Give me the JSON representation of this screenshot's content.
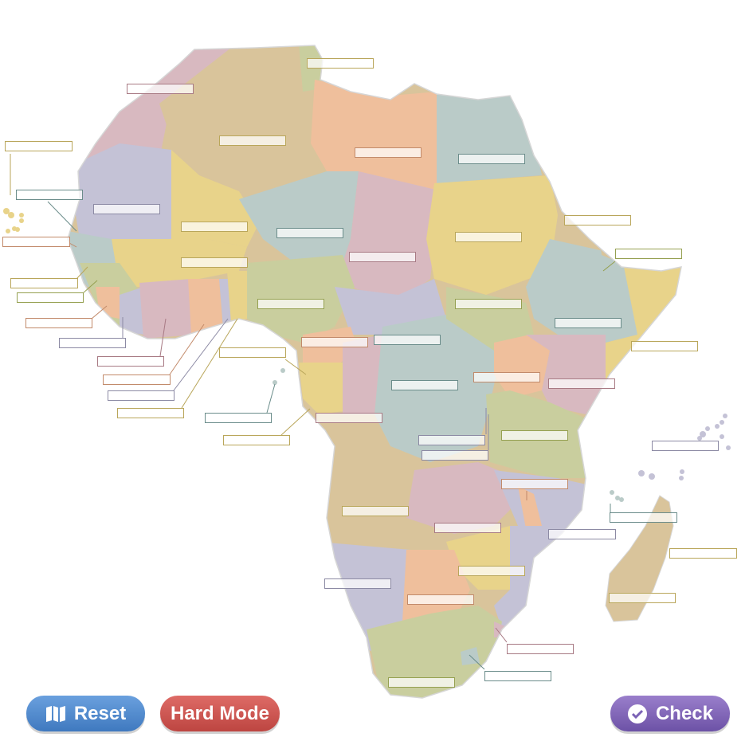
{
  "map": {
    "region": "Africa",
    "label_slot_count": 54
  },
  "buttons": {
    "reset": "Reset",
    "hard_mode": "Hard Mode",
    "check": "Check"
  },
  "icons": {
    "reset": "map-icon",
    "check": "check-circle-icon"
  },
  "colors": {
    "reset": "#4a86cc",
    "hard_mode": "#c9504b",
    "check": "#7b62b5",
    "country_palette": [
      "#d8b9c0",
      "#d9c49b",
      "#efbf9c",
      "#bacbc8",
      "#e8d38a",
      "#c9ce9e",
      "#c4c2d6"
    ]
  }
}
